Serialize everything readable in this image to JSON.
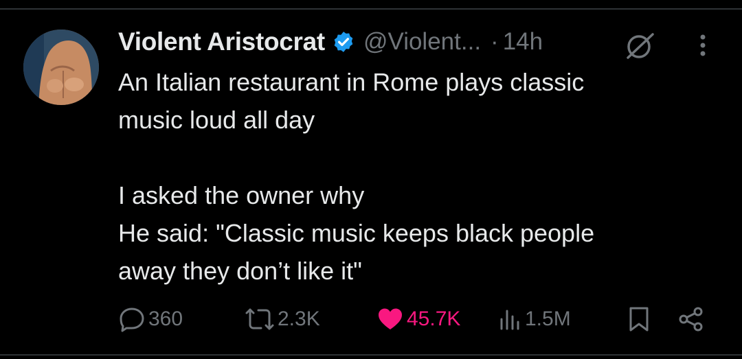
{
  "tweet": {
    "display_name": "Violent Aristocrat",
    "handle": "@Violent...",
    "separator": "·",
    "time": "14h",
    "paragraphs": [
      "An Italian restaurant in Rome plays classic\nmusic loud all day",
      "I asked the owner why\nHe said:  \"Classic music keeps black people\naway they don’t like it\""
    ]
  },
  "icons": {
    "verified": "verified-badge-icon",
    "grok": "grok-icon",
    "more": "more-options-icon",
    "reply": "reply-icon",
    "repost": "repost-icon",
    "like": "heart-icon",
    "views": "views-icon",
    "bookmark": "bookmark-icon",
    "share": "share-icon"
  },
  "actions": {
    "replies": "360",
    "reposts": "2.3K",
    "likes": "45.7K",
    "views": "1.5M"
  },
  "colors": {
    "background": "#000000",
    "text": "#e7e9ea",
    "muted": "#71767b",
    "verified": "#1d9bf0",
    "like": "#f91880"
  }
}
